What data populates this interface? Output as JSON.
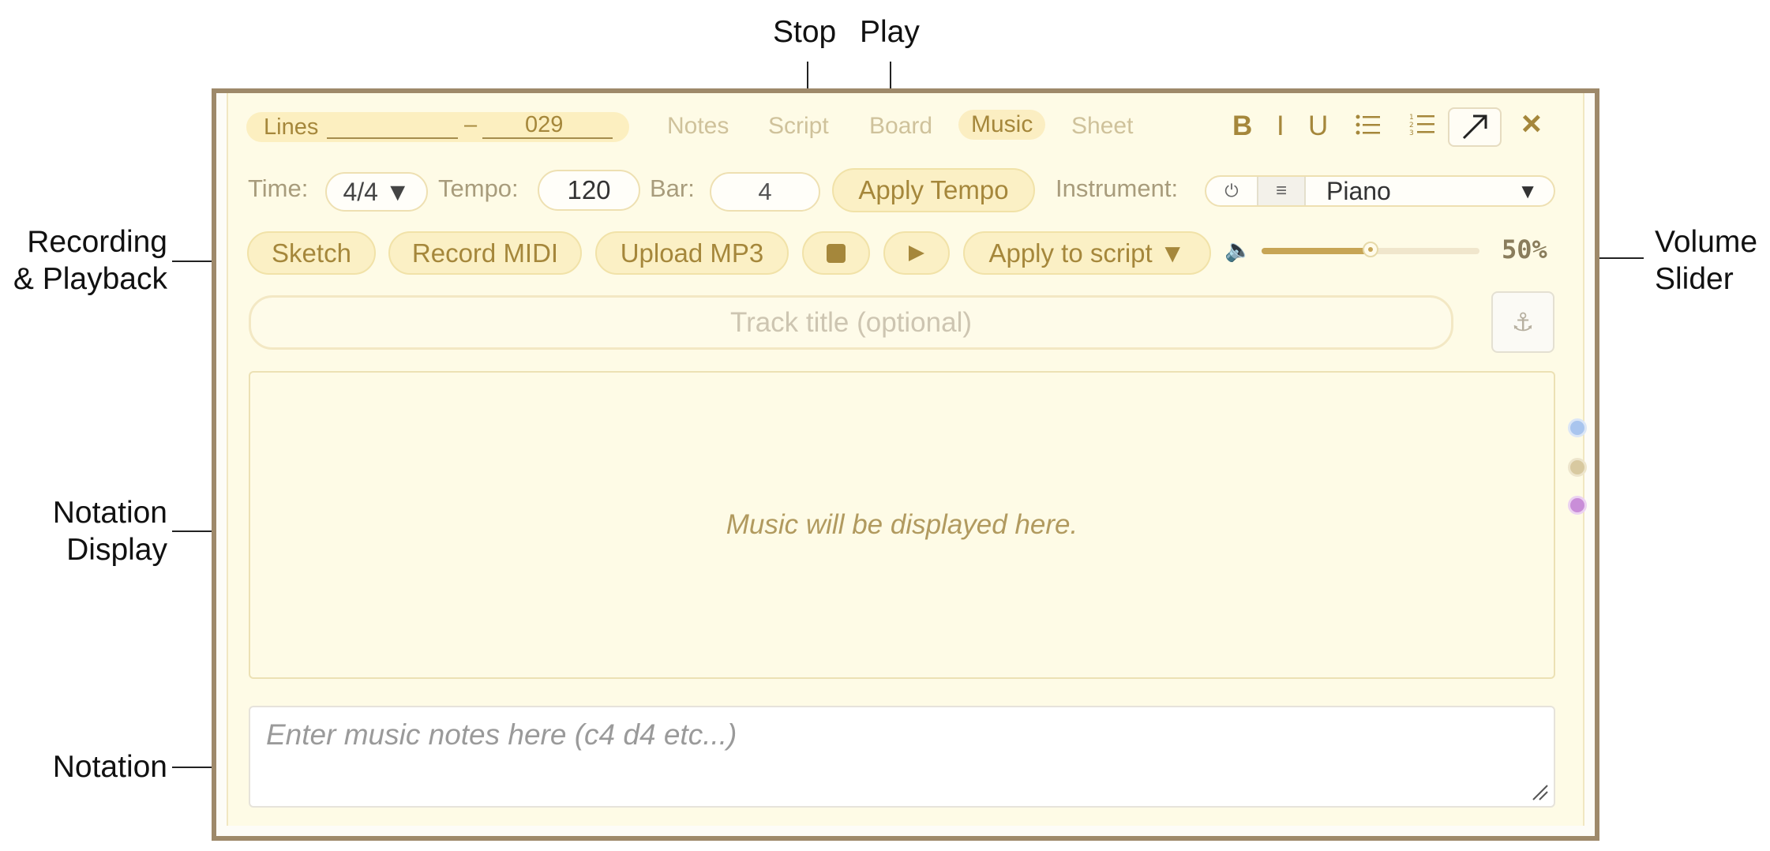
{
  "annotations": {
    "stop": "Stop",
    "play": "Play",
    "recording_line1": "Recording",
    "recording_line2": "& Playback",
    "volume_line1": "Volume",
    "volume_line2": "Slider",
    "notation_display_line1": "Notation",
    "notation_display_line2": "Display",
    "notation": "Notation"
  },
  "lines_range": {
    "label": "Lines",
    "start": "",
    "separator": "–",
    "end": "029"
  },
  "tabs": [
    {
      "label": "Notes",
      "active": false
    },
    {
      "label": "Script",
      "active": false
    },
    {
      "label": "Board",
      "active": false
    },
    {
      "label": "Music",
      "active": true
    },
    {
      "label": "Sheet",
      "active": false
    }
  ],
  "format_toolbar": {
    "bold": "B",
    "italic": "I",
    "underline": "U",
    "bulleted_list_icon": "bulleted-list-icon",
    "numbered_list_icon": "numbered-list-icon",
    "expand_icon": "expand-arrow-icon",
    "close": "×"
  },
  "settings": {
    "time_label": "Time:",
    "time_value": "4/4 ▼",
    "tempo_label": "Tempo:",
    "tempo_value": "120",
    "bar_label": "Bar:",
    "bar_value": "4",
    "apply_tempo": "Apply Tempo",
    "instrument_label": "Instrument:",
    "instrument_power_icon": "⏻",
    "instrument_menu_icon": "≡",
    "instrument_value": "Piano",
    "instrument_dropdown": "▼"
  },
  "controls": {
    "sketch": "Sketch",
    "record_midi": "Record MIDI",
    "upload_mp3": "Upload MP3",
    "stop_icon": "stop-icon",
    "play_icon": "play-icon",
    "apply_to_script": "Apply to script ▼",
    "volume_icon": "🔈",
    "volume_percent": 50,
    "volume_text": "50%"
  },
  "track_title_placeholder": "Track title (optional)",
  "anchor_icon": "⚓",
  "display_placeholder": "Music will be displayed here.",
  "notes_placeholder": "Enter music notes here (c4 d4 etc...)",
  "side_dots": [
    {
      "name": "blue-dot",
      "color": "#a9c5ee"
    },
    {
      "name": "tan-dot",
      "color": "#d8c9a0"
    },
    {
      "name": "purple-dot",
      "color": "#d8a8e4"
    }
  ],
  "colors": {
    "accent": "#a5873b",
    "panel_bg": "#fefbe6",
    "frame": "#9e896a"
  }
}
